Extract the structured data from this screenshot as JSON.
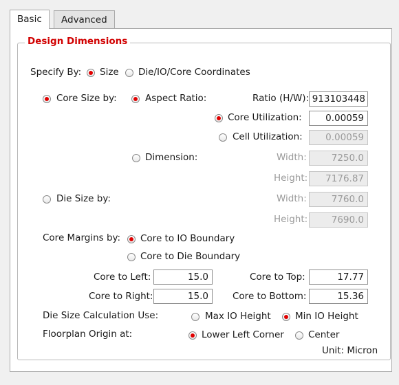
{
  "tabs": {
    "basic": "Basic",
    "advanced": "Advanced"
  },
  "group_title": "Design Dimensions",
  "specify_by": {
    "label": "Specify By:",
    "size": "Size",
    "coords": "Die/IO/Core Coordinates"
  },
  "core_size_by": "Core Size by:",
  "aspect_ratio": {
    "label": "Aspect Ratio:",
    "ratio_label": "Ratio (H/W):",
    "ratio_value": "913103448",
    "core_util_label": "Core Utilization:",
    "core_util_value": "0.00059",
    "cell_util_label": "Cell Utilization:",
    "cell_util_value": "0.00059"
  },
  "dimension": {
    "label": "Dimension:",
    "width_label": "Width:",
    "width_value": "7250.0",
    "height_label": "Height:",
    "height_value": "7176.87"
  },
  "die_size": {
    "label": "Die Size by:",
    "width_label": "Width:",
    "width_value": "7760.0",
    "height_label": "Height:",
    "height_value": "7690.0"
  },
  "core_margins": {
    "label": "Core Margins by:",
    "io": "Core to IO Boundary",
    "die": "Core to Die Boundary"
  },
  "margins": {
    "left_label": "Core to Left:",
    "left_value": "15.0",
    "right_label": "Core to Right:",
    "right_value": "15.0",
    "top_label": "Core to Top:",
    "top_value": "17.77",
    "bottom_label": "Core to Bottom:",
    "bottom_value": "15.36"
  },
  "die_calc": {
    "label": "Die Size Calculation Use:",
    "max": "Max IO Height",
    "min": "Min IO Height"
  },
  "origin": {
    "label": "Floorplan Origin at:",
    "lower_left": "Lower Left Corner",
    "center": "Center"
  },
  "unit": "Unit: Micron"
}
